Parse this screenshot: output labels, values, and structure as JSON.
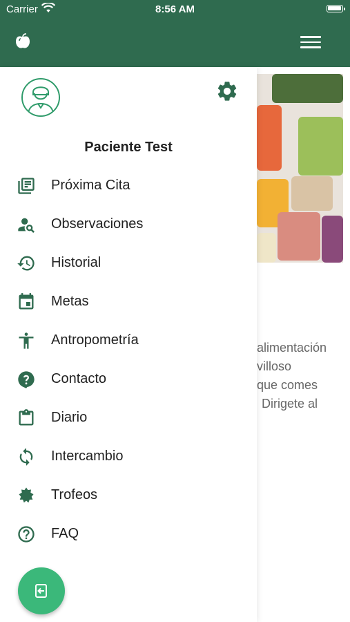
{
  "status_bar": {
    "carrier": "Carrier",
    "time": "8:56 AM",
    "battery_level": 0.9
  },
  "colors": {
    "primary": "#2f6b4f",
    "icon_green": "#2f6b4f",
    "fab": "#3bb87a"
  },
  "drawer": {
    "user_name": "Paciente Test",
    "items": [
      {
        "label": "Próxima Cita",
        "icon": "appointment-icon"
      },
      {
        "label": "Observaciones",
        "icon": "person-search-icon"
      },
      {
        "label": "Historial",
        "icon": "history-icon"
      },
      {
        "label": "Metas",
        "icon": "calendar-icon"
      },
      {
        "label": "Antropometría",
        "icon": "accessibility-icon"
      },
      {
        "label": "Contacto",
        "icon": "help-bubble-icon"
      },
      {
        "label": "Diario",
        "icon": "clipboard-icon"
      },
      {
        "label": "Intercambio",
        "icon": "sync-icon"
      },
      {
        "label": "Trofeos",
        "icon": "badge-icon"
      },
      {
        "label": "FAQ",
        "icon": "help-circle-icon"
      }
    ]
  },
  "background": {
    "lines": [
      "alimentación",
      "villoso",
      "que comes",
      "Dirigete al"
    ]
  }
}
